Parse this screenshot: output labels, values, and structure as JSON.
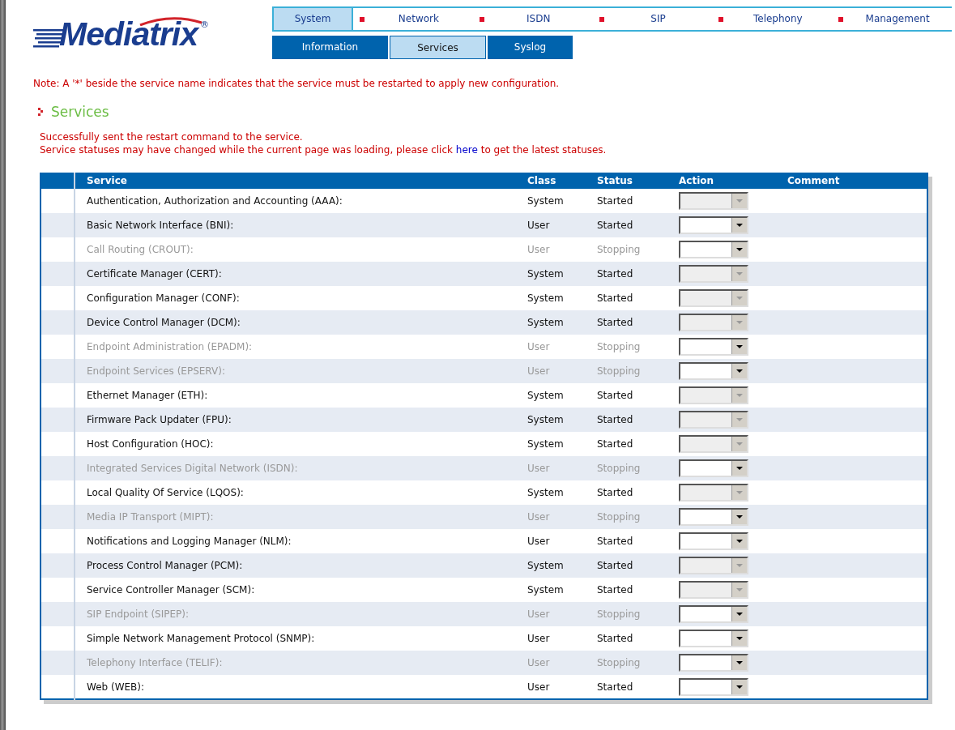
{
  "logo": {
    "text": "Mediatrix",
    "mark": "®"
  },
  "main_tabs": [
    {
      "label": "System",
      "selected": true
    },
    {
      "label": "Network",
      "selected": false
    },
    {
      "label": "ISDN",
      "selected": false
    },
    {
      "label": "SIP",
      "selected": false
    },
    {
      "label": "Telephony",
      "selected": false
    },
    {
      "label": "Management",
      "selected": false
    }
  ],
  "sub_tabs": [
    {
      "label": "Information",
      "selected": false
    },
    {
      "label": "Services",
      "selected": true
    },
    {
      "label": "Syslog",
      "selected": false
    }
  ],
  "note": "Note: A '*' beside the service name indicates that the service must be restarted to apply new configuration.",
  "heading": "Services",
  "messages": {
    "line_1": "Successfully sent the restart command to the service.",
    "line_2_before": "Service statuses may have changed while the current page was loading, please click",
    "link": "here",
    "line_2_after": "to get the latest statuses."
  },
  "table": {
    "columns": [
      "Service",
      "Class",
      "Status",
      "Action",
      "Comment"
    ],
    "rows": [
      {
        "service": "Authentication, Authorization and Accounting (AAA):",
        "class": "System",
        "status": "Started",
        "dimmed": false,
        "action_disabled": true
      },
      {
        "service": "Basic Network Interface (BNI):",
        "class": "User",
        "status": "Started",
        "dimmed": false,
        "action_disabled": false
      },
      {
        "service": "Call Routing (CROUT):",
        "class": "User",
        "status": "Stopping",
        "dimmed": true,
        "action_disabled": false
      },
      {
        "service": "Certificate Manager (CERT):",
        "class": "System",
        "status": "Started",
        "dimmed": false,
        "action_disabled": true
      },
      {
        "service": "Configuration Manager (CONF):",
        "class": "System",
        "status": "Started",
        "dimmed": false,
        "action_disabled": true
      },
      {
        "service": "Device Control Manager (DCM):",
        "class": "System",
        "status": "Started",
        "dimmed": false,
        "action_disabled": true
      },
      {
        "service": "Endpoint Administration (EPADM):",
        "class": "User",
        "status": "Stopping",
        "dimmed": true,
        "action_disabled": false
      },
      {
        "service": "Endpoint Services (EPSERV):",
        "class": "User",
        "status": "Stopping",
        "dimmed": true,
        "action_disabled": false
      },
      {
        "service": "Ethernet Manager (ETH):",
        "class": "System",
        "status": "Started",
        "dimmed": false,
        "action_disabled": true
      },
      {
        "service": "Firmware Pack Updater (FPU):",
        "class": "System",
        "status": "Started",
        "dimmed": false,
        "action_disabled": true
      },
      {
        "service": "Host Configuration (HOC):",
        "class": "System",
        "status": "Started",
        "dimmed": false,
        "action_disabled": true
      },
      {
        "service": "Integrated Services Digital Network (ISDN):",
        "class": "User",
        "status": "Stopping",
        "dimmed": true,
        "action_disabled": false
      },
      {
        "service": "Local Quality Of Service (LQOS):",
        "class": "System",
        "status": "Started",
        "dimmed": false,
        "action_disabled": true
      },
      {
        "service": "Media IP Transport (MIPT):",
        "class": "User",
        "status": "Stopping",
        "dimmed": true,
        "action_disabled": false
      },
      {
        "service": "Notifications and Logging Manager (NLM):",
        "class": "User",
        "status": "Started",
        "dimmed": false,
        "action_disabled": false
      },
      {
        "service": "Process Control Manager (PCM):",
        "class": "System",
        "status": "Started",
        "dimmed": false,
        "action_disabled": true
      },
      {
        "service": "Service Controller Manager (SCM):",
        "class": "System",
        "status": "Started",
        "dimmed": false,
        "action_disabled": true
      },
      {
        "service": "SIP Endpoint (SIPEP):",
        "class": "User",
        "status": "Stopping",
        "dimmed": true,
        "action_disabled": false
      },
      {
        "service": "Simple Network Management Protocol (SNMP):",
        "class": "User",
        "status": "Started",
        "dimmed": false,
        "action_disabled": false
      },
      {
        "service": "Telephony Interface (TELIF):",
        "class": "User",
        "status": "Stopping",
        "dimmed": true,
        "action_disabled": false
      },
      {
        "service": "Web (WEB):",
        "class": "User",
        "status": "Started",
        "dimmed": false,
        "action_disabled": false
      }
    ]
  }
}
